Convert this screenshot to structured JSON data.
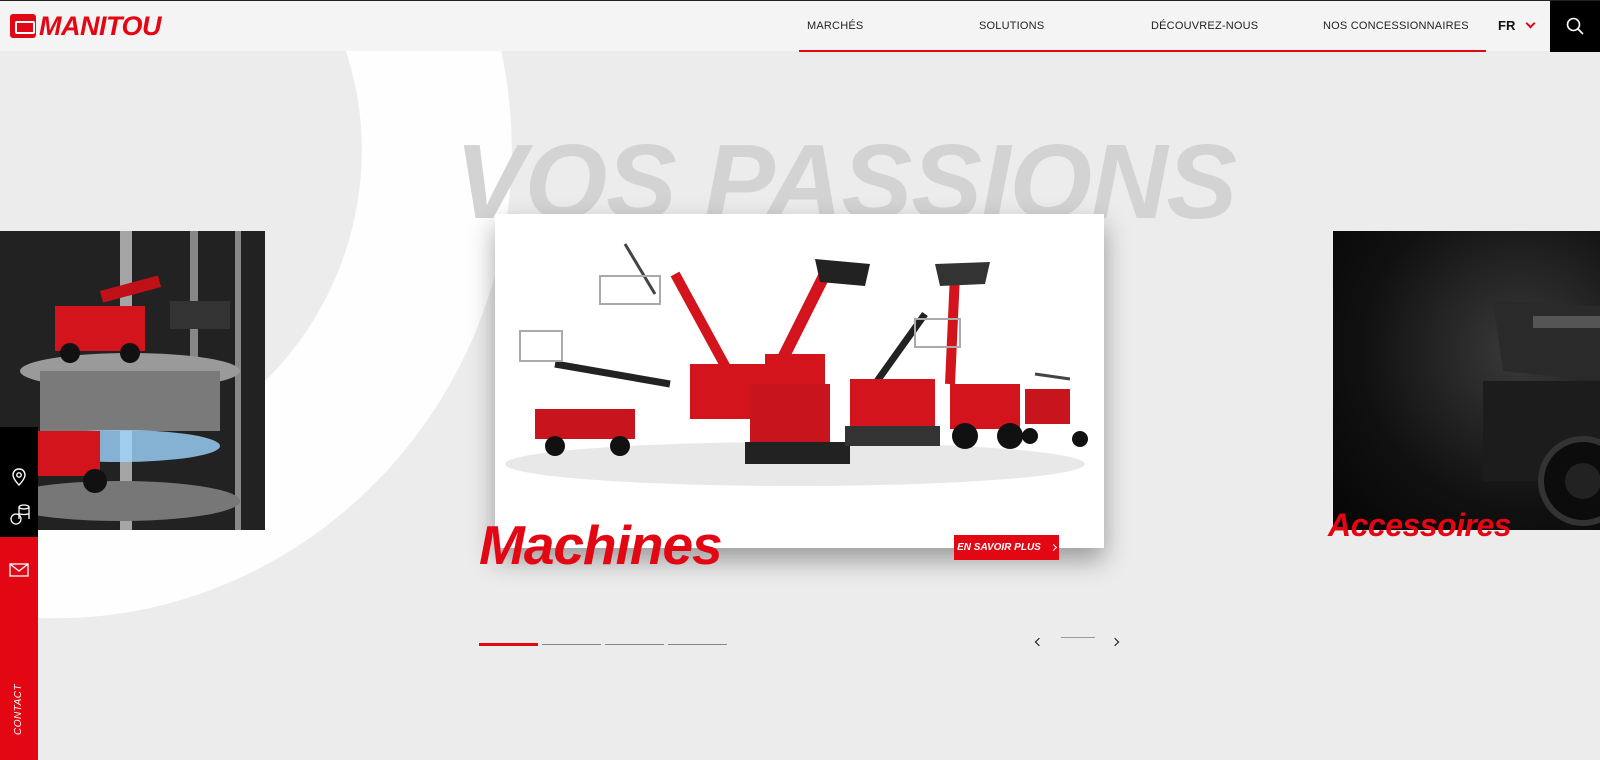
{
  "brand": {
    "name": "MANITOU",
    "color": "#e30613"
  },
  "nav": {
    "items": [
      "MARCHÉS",
      "SOLUTIONS",
      "DÉCOUVREZ-NOUS",
      "NOS CONCESSIONNAIRES"
    ],
    "language": "FR"
  },
  "hero": {
    "background_title": "VOS PASSIONS",
    "main_card_title": "Machines",
    "cta_label": "EN SAVOIR PLUS",
    "next_card_title": "Accessoires"
  },
  "pagination": {
    "total": 4,
    "active": 1
  },
  "side_bar": {
    "contact_label": "CONTACT"
  },
  "icons": [
    "search-icon",
    "chevron-down-icon",
    "location-pin-icon",
    "coins-icon",
    "mail-icon",
    "chevron-left-icon",
    "chevron-right-icon"
  ]
}
